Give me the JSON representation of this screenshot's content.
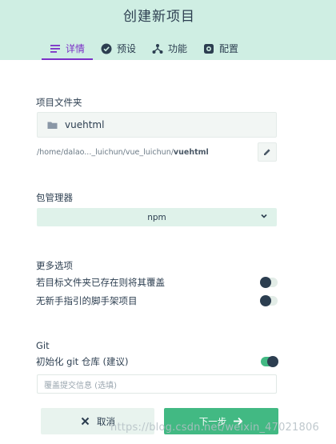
{
  "header": {
    "title": "创建新项目",
    "tabs": [
      {
        "label": "详情",
        "icon": "details-list-icon",
        "active": true
      },
      {
        "label": "预设",
        "icon": "check-circle-icon",
        "active": false
      },
      {
        "label": "功能",
        "icon": "features-branch-icon",
        "active": false
      },
      {
        "label": "配置",
        "icon": "settings-gear-icon",
        "active": false
      }
    ]
  },
  "folder_section": {
    "label": "项目文件夹",
    "value": "vuehtml",
    "path_prefix": "/home/dalao..._luichun/vue_luichun/",
    "path_bold": "vuehtml"
  },
  "package_manager": {
    "label": "包管理器",
    "selected": "npm"
  },
  "more_options": {
    "label": "更多选项",
    "options": [
      {
        "label": "若目标文件夹已存在则将其覆盖",
        "enabled": false
      },
      {
        "label": "无新手指引的脚手架项目",
        "enabled": false
      }
    ]
  },
  "git": {
    "label": "Git",
    "init_label": "初始化 git 仓库 (建议)",
    "init_enabled": true,
    "commit_placeholder": "覆盖提交信息 (选填)"
  },
  "actions": {
    "cancel_label": "取消",
    "next_label": "下一步"
  },
  "watermark": "https://blog.csdn.net/weixin_47021806",
  "colors": {
    "header_bg": "#cfeee3",
    "accent_purple": "#7b30c7",
    "accent_green": "#42b983",
    "text_dark": "#2c3e50"
  }
}
